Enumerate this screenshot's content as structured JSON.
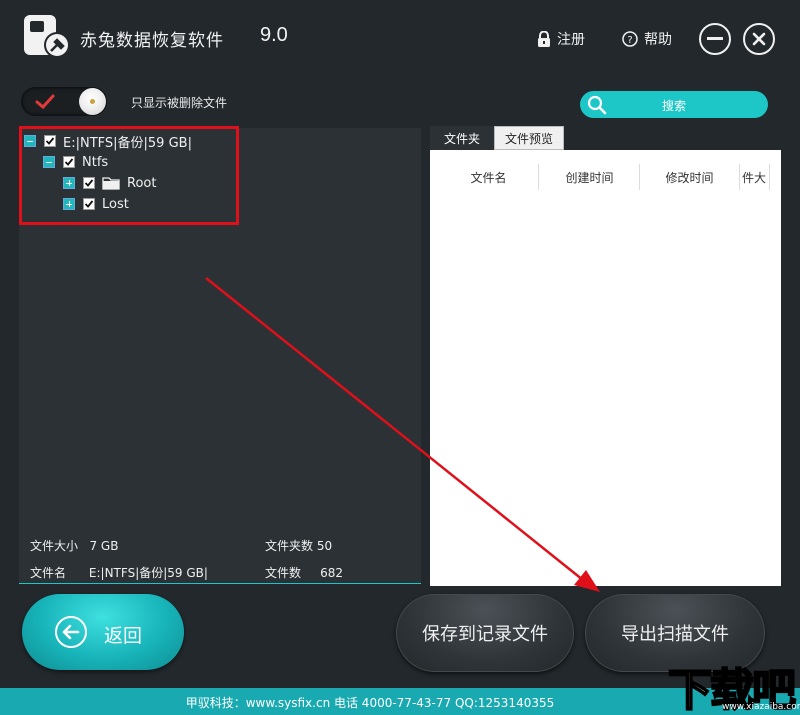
{
  "app": {
    "title": "赤兔数据恢复软件",
    "version": "9.0",
    "register_label": "注册",
    "help_label": "帮助"
  },
  "filter": {
    "label": "只显示被删除文件"
  },
  "search": {
    "label": "搜索"
  },
  "tree": {
    "root": "E:|NTFS|备份|59 GB|",
    "level1": "Ntfs",
    "children": [
      "Root",
      "Lost"
    ]
  },
  "info": {
    "file_size_label": "文件大小",
    "file_size_value": "7 GB",
    "folder_count_label": "文件夹数",
    "folder_count_value": "50",
    "file_name_label": "文件名",
    "file_name_value": "E:|NTFS|备份|59 GB|",
    "file_count_label": "文件数",
    "file_count_value": "682"
  },
  "tabs": [
    "文件夹",
    "文件预览"
  ],
  "columns": [
    "文件名",
    "创建时间",
    "修改时间",
    "件大"
  ],
  "buttons": {
    "back": "返回",
    "save_record": "保存到记录文件",
    "export_scan": "导出扫描文件"
  },
  "footer": {
    "text": "甲驭科技：www.sysfix.cn 电话 4000-77-43-77 QQ:1253140355"
  },
  "watermark": {
    "big": "下载吧",
    "small": "www.xiazaiba.com"
  },
  "colors": {
    "background": "#22282c",
    "panel": "#2b3135",
    "accent": "#1ec7c7",
    "annotation_red": "#e0101a"
  }
}
